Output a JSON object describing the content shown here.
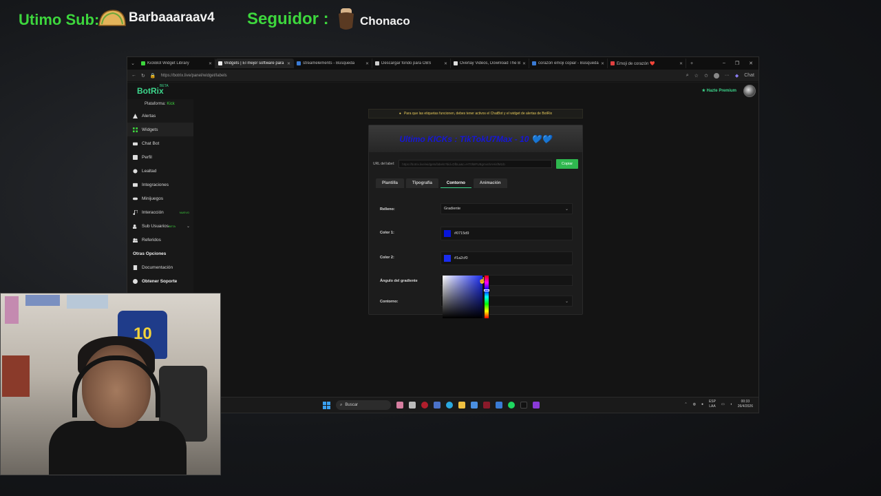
{
  "overlay": {
    "sub_label": "Utimo Sub:",
    "sub_name": "Barbaaaraav4",
    "follower_label": "Seguidor :",
    "follower_name": "Chonaco"
  },
  "browser": {
    "tabs": [
      {
        "label": "KickBot Widget Library",
        "active": false
      },
      {
        "label": "Widgets | El mejor software para s",
        "active": true
      },
      {
        "label": "streamelements - Búsqueda",
        "active": false
      },
      {
        "label": "Descargar fondo para OBS",
        "active": false
      },
      {
        "label": "Overlay Videos, Download The B",
        "active": false
      },
      {
        "label": "corazón emoji copiar - Búsqueda",
        "active": false
      },
      {
        "label": "Emoji de corazón ❤️",
        "active": false
      }
    ],
    "url": "https://botrix.live/panel/widget/labels",
    "chat_label": "Chat"
  },
  "site": {
    "logo": "BotRix",
    "beta": "BETA",
    "premium": "Hazte Premium",
    "platform_label": "Plataforma:",
    "platform_value": "Kick"
  },
  "sidebar": {
    "items": [
      {
        "label": "Alertas",
        "icon": "warning-icon"
      },
      {
        "label": "Widgets",
        "icon": "grid-icon",
        "active": true
      },
      {
        "label": "Chat Bot",
        "icon": "robot-icon"
      },
      {
        "label": "Perfil",
        "icon": "profile-icon"
      },
      {
        "label": "Lealtad",
        "icon": "loyalty-icon"
      },
      {
        "label": "Integraciones",
        "icon": "integrations-icon"
      },
      {
        "label": "Minijuegos",
        "icon": "gamepad-icon"
      },
      {
        "label": "Interacción",
        "icon": "music-icon",
        "badge": "NUEVO"
      },
      {
        "label": "Sub Usuarios",
        "icon": "users-icon",
        "badge": "BETA"
      },
      {
        "label": "Referidos",
        "icon": "referrals-icon"
      }
    ],
    "section_title": "Otras Opciones",
    "other_items": [
      {
        "label": "Documentación",
        "icon": "doc-icon"
      },
      {
        "label": "Obtener Soporte",
        "icon": "help-icon"
      }
    ]
  },
  "main": {
    "notice": "Para que las etiquetas funcionen, debes tener activos el ChatBot y el widget de alertas de BotRix",
    "preview_text": "Ultimo KICKs : TikTokU7Max - 10 💙💙",
    "url_label": "URL del label:",
    "url_value": "https://botrix.live/widgets/labels?bid=DfbLa&c=HT0lMFUBgmvnhAHisfM1Ib",
    "copy_button": "Copiar",
    "tabs": [
      "Plantilla",
      "Tipografía",
      "Contorno",
      "Animación"
    ],
    "active_tab": "Contorno",
    "form": {
      "fill_label": "Relleno:",
      "fill_value": "Gradiente",
      "color1_label": "Color 1:",
      "color1_value": "#0715d9",
      "color2_label": "Color 2:",
      "color2_value": "#1a2cf0",
      "angle_label": "Ángulo del gradiente",
      "outline_label": "Contorno:"
    }
  },
  "taskbar": {
    "search": "Buscar",
    "lang_top": "ESP",
    "lang_bottom": "LAA",
    "time": "00:33",
    "date": "26/4/2026"
  },
  "colors": {
    "accent_green": "#3dd68c",
    "overlay_green": "#3dd63d",
    "preview_blue": "#1616d6",
    "color1": "#0715d9",
    "color2": "#1a2cf0",
    "copy_button": "#2fb84f"
  }
}
